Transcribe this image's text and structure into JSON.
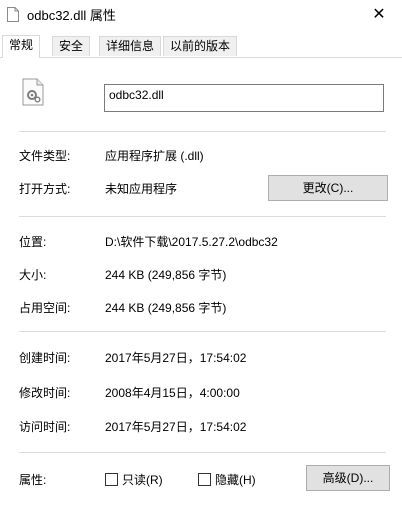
{
  "window": {
    "title": "odbc32.dll 属性",
    "close_glyph": "✕"
  },
  "tabs": [
    {
      "label": "常规",
      "active": true
    },
    {
      "label": "安全",
      "active": false
    },
    {
      "label": "详细信息",
      "active": false
    },
    {
      "label": "以前的版本",
      "active": false
    }
  ],
  "general": {
    "file_name": "odbc32.dll",
    "type_label": "文件类型:",
    "type_value": "应用程序扩展 (.dll)",
    "open_label": "打开方式:",
    "open_value": "未知应用程序",
    "change_button": "更改(C)...",
    "location_label": "位置:",
    "location_value": "D:\\软件下载\\2017.5.27.2\\odbc32",
    "size_label": "大小:",
    "size_value": "244 KB (249,856 字节)",
    "disk_label": "占用空间:",
    "disk_value": "244 KB (249,856 字节)",
    "created_label": "创建时间:",
    "created_value": "2017年5月27日，17:54:02",
    "modified_label": "修改时间:",
    "modified_value": "2008年4月15日，4:00:00",
    "accessed_label": "访问时间:",
    "accessed_value": "2017年5月27日，17:54:02",
    "attributes_label": "属性:",
    "readonly_label": "只读(R)",
    "readonly_checked": false,
    "hidden_label": "隐藏(H)",
    "hidden_checked": false,
    "advanced_button": "高级(D)..."
  },
  "icons": {
    "title_icon": "file-icon",
    "file_icon": "dll-gear-file-icon"
  }
}
